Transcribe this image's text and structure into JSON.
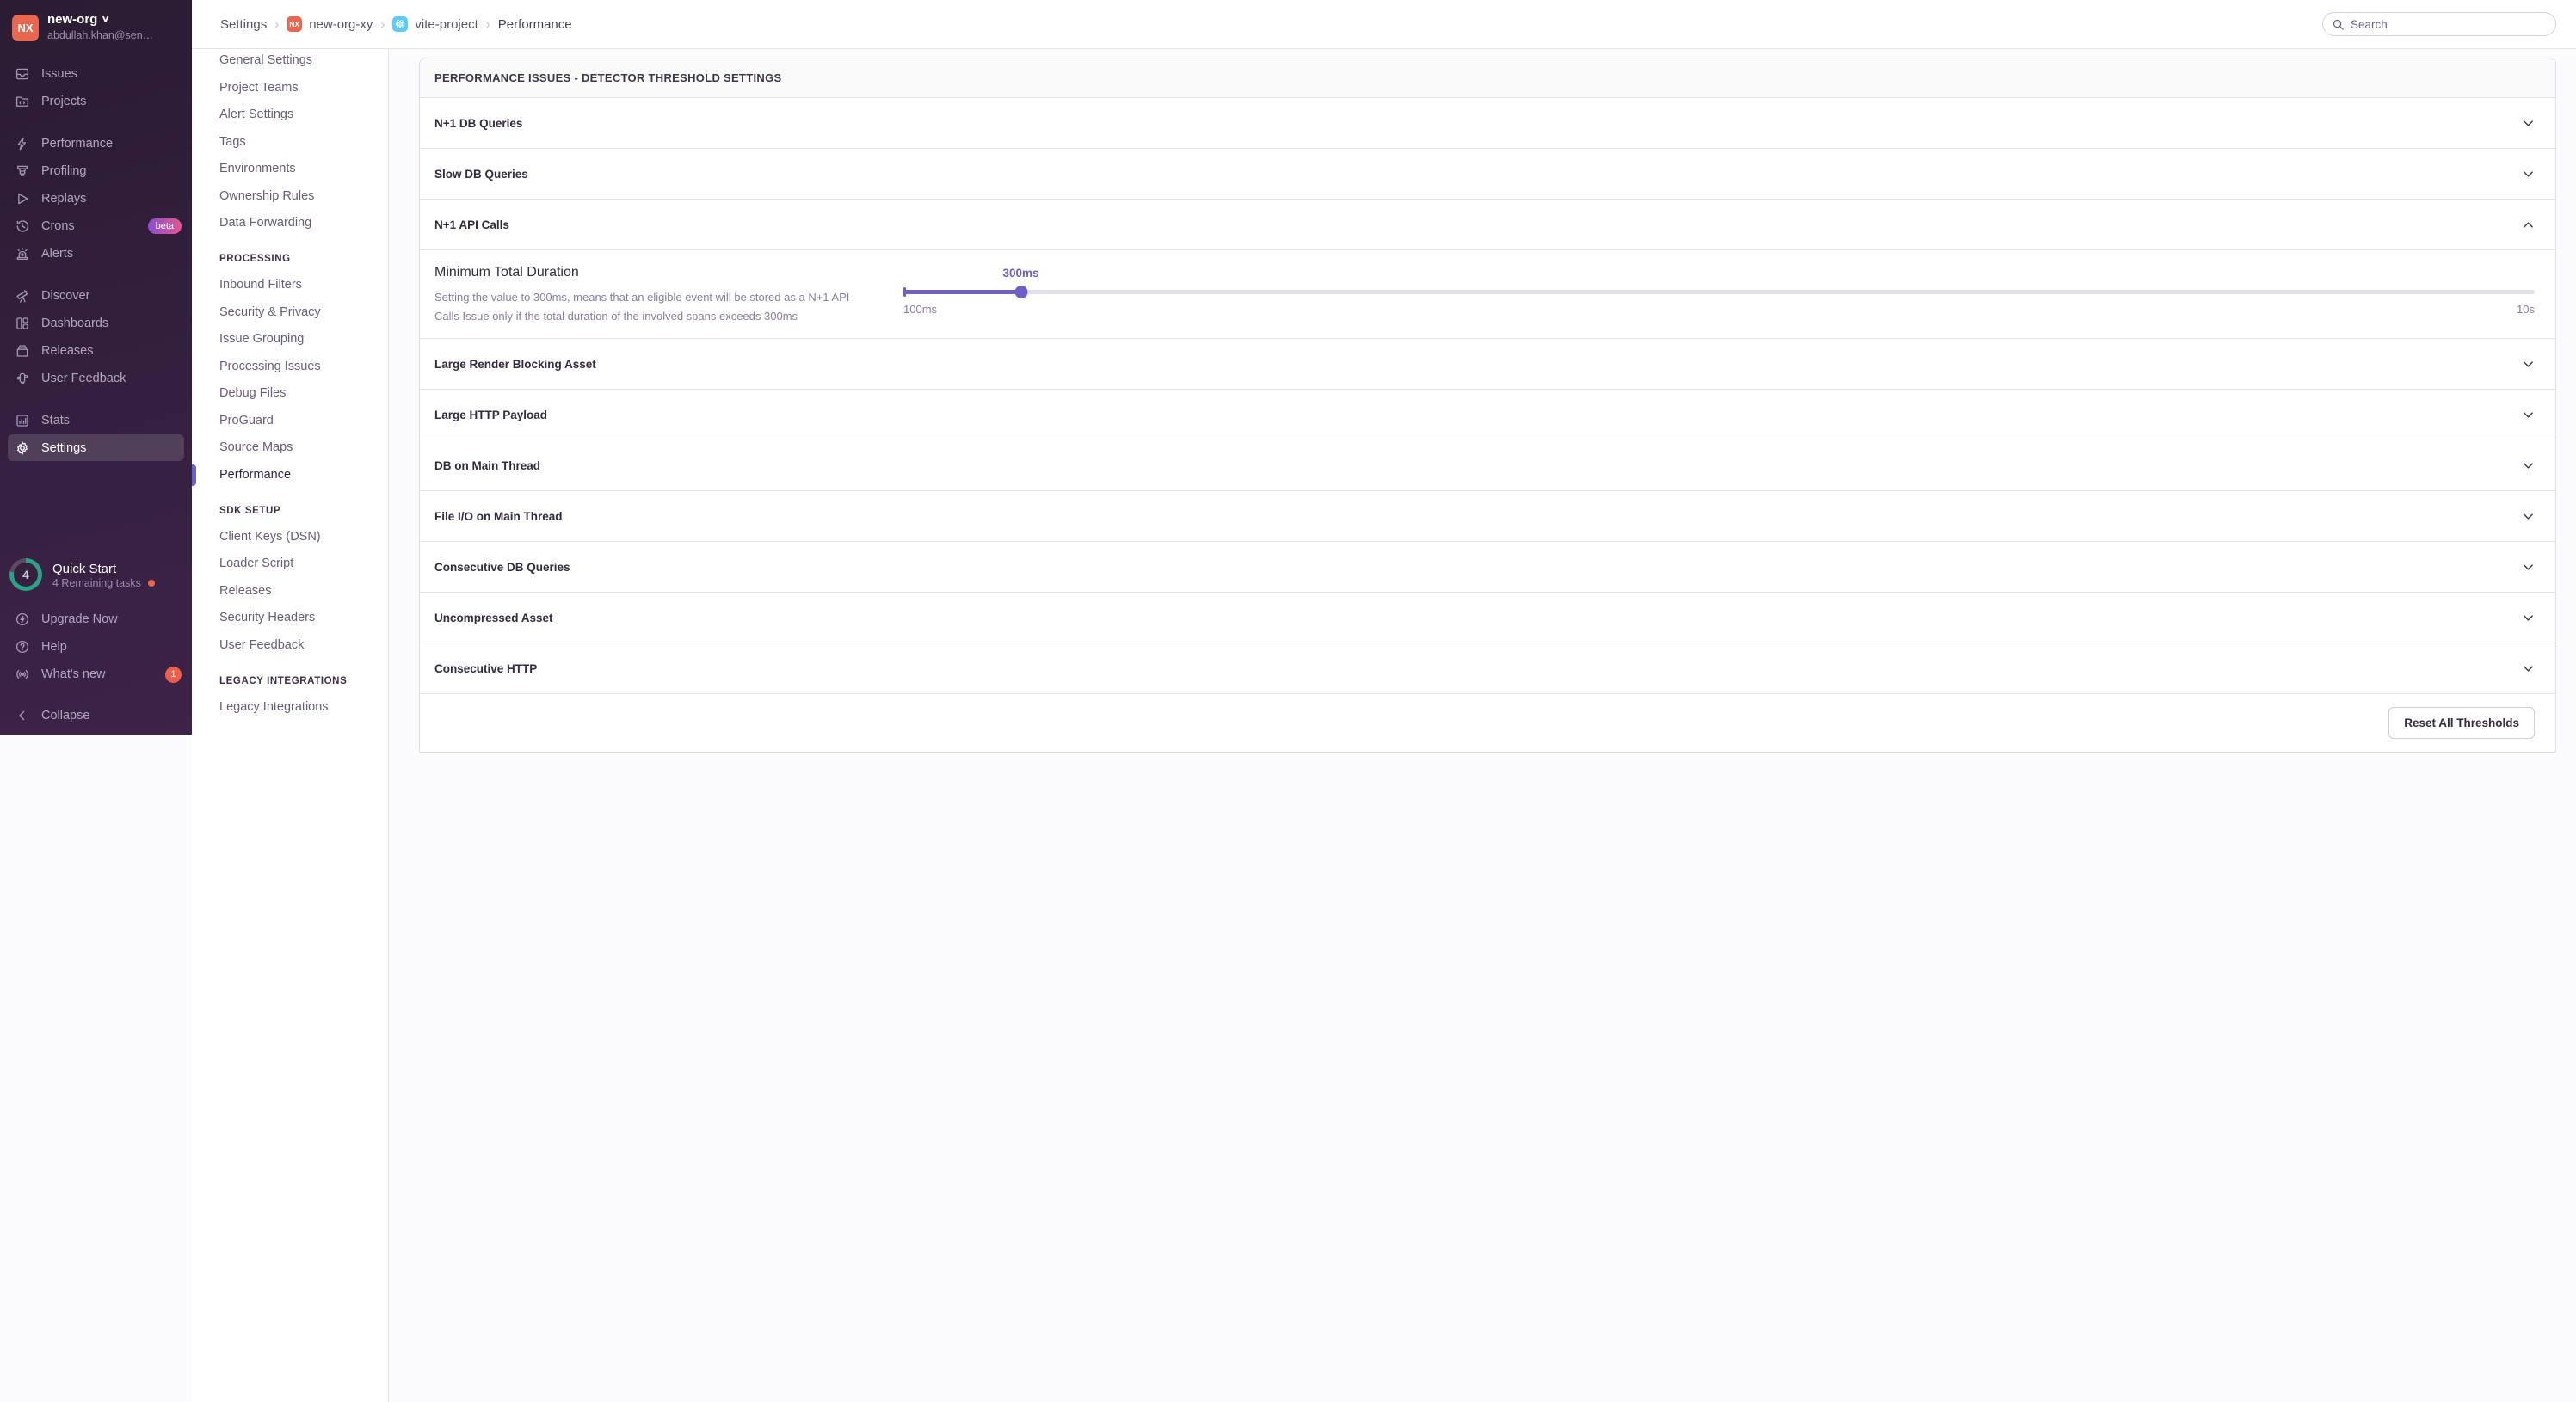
{
  "colors": {
    "accent": "#6c5fc7",
    "coral": "#e9674f",
    "teal": "#2ba185",
    "badge-red": "#ef5e4b",
    "beta-purple": "#8a4fce",
    "beta-pink": "#e4568f",
    "react-cyan": "#5bccf5",
    "sidebar-bg": "#33203d"
  },
  "org": {
    "avatar_initials": "NX",
    "name": "new-org",
    "email": "abdullah.khan@sen…"
  },
  "sidebar": {
    "groups": [
      {
        "items": [
          {
            "label": "Issues"
          },
          {
            "label": "Projects"
          }
        ]
      },
      {
        "items": [
          {
            "label": "Performance"
          },
          {
            "label": "Profiling"
          },
          {
            "label": "Replays"
          },
          {
            "label": "Crons",
            "badge": "beta"
          },
          {
            "label": "Alerts"
          }
        ]
      },
      {
        "items": [
          {
            "label": "Discover"
          },
          {
            "label": "Dashboards"
          },
          {
            "label": "Releases"
          },
          {
            "label": "User Feedback"
          }
        ]
      },
      {
        "items": [
          {
            "label": "Stats"
          },
          {
            "label": "Settings"
          }
        ]
      }
    ],
    "quick_start": {
      "label": "Quick Start",
      "sub": "4 Remaining tasks",
      "count": "4",
      "percent": 78
    },
    "upgrade_label": "Upgrade Now",
    "help_label": "Help",
    "whats_new_label": "What's new",
    "whats_new_badge": "1",
    "collapse_label": "Collapse"
  },
  "topbar": {
    "breadcrumbs": [
      {
        "label": "Settings"
      },
      {
        "label": "new-org-xy",
        "icon": "nx-org-icon",
        "icon_text": "NX"
      },
      {
        "label": "vite-project",
        "icon": "react-project-icon"
      },
      {
        "label": "Performance"
      }
    ],
    "search_placeholder": "Search"
  },
  "settings_nav": {
    "sections": [
      {
        "header": "",
        "items": [
          "General Settings",
          "Project Teams",
          "Alert Settings",
          "Tags",
          "Environments",
          "Ownership Rules",
          "Data Forwarding"
        ]
      },
      {
        "header": "PROCESSING",
        "items": [
          "Inbound Filters",
          "Security & Privacy",
          "Issue Grouping",
          "Processing Issues",
          "Debug Files",
          "ProGuard",
          "Source Maps",
          "Performance"
        ]
      },
      {
        "header": "SDK SETUP",
        "items": [
          "Client Keys (DSN)",
          "Loader Script",
          "Releases",
          "Security Headers",
          "User Feedback"
        ]
      },
      {
        "header": "LEGACY INTEGRATIONS",
        "items": [
          "Legacy Integrations"
        ]
      }
    ],
    "active_item": "Performance"
  },
  "main": {
    "panel_title": "PERFORMANCE ISSUES - DETECTOR THRESHOLD SETTINGS",
    "rows": [
      {
        "label": "N+1 DB Queries",
        "expanded": false
      },
      {
        "label": "Slow DB Queries",
        "expanded": false
      },
      {
        "label": "N+1 API Calls",
        "expanded": true
      },
      {
        "label": "Large Render Blocking Asset",
        "expanded": false
      },
      {
        "label": "Large HTTP Payload",
        "expanded": false
      },
      {
        "label": "DB on Main Thread",
        "expanded": false
      },
      {
        "label": "File I/O on Main Thread",
        "expanded": false
      },
      {
        "label": "Consecutive DB Queries",
        "expanded": false
      },
      {
        "label": "Uncompressed Asset",
        "expanded": false
      },
      {
        "label": "Consecutive HTTP",
        "expanded": false
      }
    ],
    "threshold": {
      "title": "Minimum Total Duration",
      "description": "Setting the value to 300ms, means that an eligible event will be stored as a N+1 API Calls Issue only if the total duration of the involved spans exceeds 300ms",
      "value_label": "300ms",
      "min_label": "100ms",
      "max_label": "10s",
      "percent": 7.2
    },
    "reset_button": "Reset All Thresholds"
  }
}
